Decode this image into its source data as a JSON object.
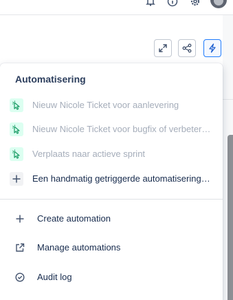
{
  "header": {
    "icons": [
      "bell-icon",
      "info-icon",
      "gear-icon",
      "avatar"
    ]
  },
  "toolbar": {
    "buttons": [
      {
        "name": "expand-icon"
      },
      {
        "name": "share-icon"
      },
      {
        "name": "lightning-icon",
        "active": true
      }
    ]
  },
  "popup": {
    "title": "Automatisering",
    "rules": [
      {
        "label": "Nieuw Nicole Ticket voor aanlevering",
        "icon": "cursor-click-icon",
        "disabled": true
      },
      {
        "label": "Nieuw Nicole Ticket voor bugfix of verbetering",
        "icon": "cursor-click-icon",
        "disabled": true
      },
      {
        "label": "Verplaats naar actieve sprint",
        "icon": "cursor-click-icon",
        "disabled": true
      },
      {
        "label": "Een handmatig getriggerde automatisering t…",
        "icon": "plus-icon",
        "disabled": false
      }
    ],
    "actions": [
      {
        "label": "Create automation",
        "icon": "plus-icon"
      },
      {
        "label": "Manage automations",
        "icon": "external-link-icon"
      },
      {
        "label": "Audit log",
        "icon": "check-circle-icon"
      }
    ]
  },
  "colors": {
    "accent": "#1d7afc",
    "rule_icon_bg": "#dcfff1",
    "rule_icon_fg": "#22a06b",
    "disabled_text": "#a5adba",
    "text": "#172b4d"
  }
}
